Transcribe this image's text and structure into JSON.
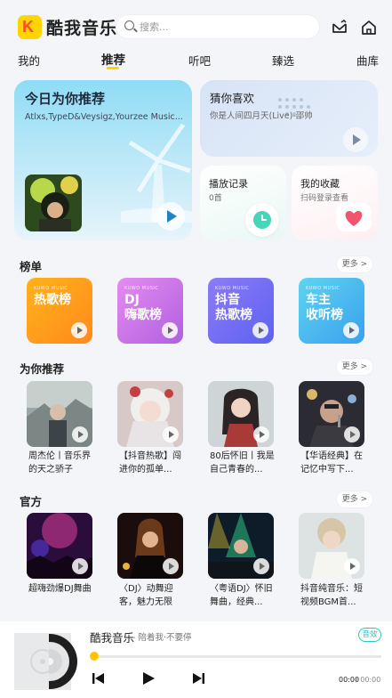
{
  "header": {
    "app_name": "酷我音乐",
    "logo_letter": "K",
    "search_placeholder": "搜索..."
  },
  "tabs": [
    {
      "label": "我的"
    },
    {
      "label": "推荐",
      "active": true
    },
    {
      "label": "听吧"
    },
    {
      "label": "臻选"
    },
    {
      "label": "曲库"
    }
  ],
  "daily": {
    "title": "今日为你推荐",
    "subtitle": "Atlxs,TypeD&Veysigz,Yourzee Music..."
  },
  "guess": {
    "title": "猜你喜欢",
    "subtitle": "你是人间四月天(Live)-邵帅"
  },
  "history": {
    "title": "播放记录",
    "count": "0首"
  },
  "favorites": {
    "title": "我的收藏",
    "subtitle": "扫码登录查看"
  },
  "charts_section": {
    "title": "榜单",
    "more": "更多 >",
    "items": [
      {
        "name": "热歌榜",
        "brand": "KUWO MUSIC",
        "color_from": "#ffb21a",
        "color_to": "#ff8a1d"
      },
      {
        "name": "DJ\n嗨歌榜",
        "brand": "KUWO MUSIC",
        "color_from": "#e58cf0",
        "color_to": "#b060e0"
      },
      {
        "name": "抖音\n热歌榜",
        "brand": "KUWO MUSIC",
        "color_from": "#8d7bf7",
        "color_to": "#5c62f0"
      },
      {
        "name": "车主\n收听榜",
        "brand": "KUWO MUSIC",
        "color_from": "#5fd4f0",
        "color_to": "#3aa0ee"
      }
    ]
  },
  "recommend_section": {
    "title": "为你推荐",
    "more": "更多 >",
    "items": [
      {
        "caption": "周杰伦丨音乐界的天之骄子"
      },
      {
        "caption": "【抖音热歌】闯进你的孤单..."
      },
      {
        "caption": "80后怀旧丨我是自己青春的..."
      },
      {
        "caption": "【华语经典】在记忆中写下..."
      }
    ]
  },
  "official_section": {
    "title": "官方",
    "more": "更多 >",
    "items": [
      {
        "caption": "超嗨劲爆DJ舞曲"
      },
      {
        "caption": "〈DJ〉动舞迎客，魅力无限"
      },
      {
        "caption": "〈粤语DJ〉怀旧舞曲，经典..."
      },
      {
        "caption": "抖音纯音乐：短视频BGM首..."
      }
    ]
  },
  "player": {
    "title": "酷我音乐",
    "artist": "- 陪着我·不要停",
    "badge": "音效",
    "progress": 0,
    "time_current": "00:00",
    "time_total": "/ 00:00"
  }
}
